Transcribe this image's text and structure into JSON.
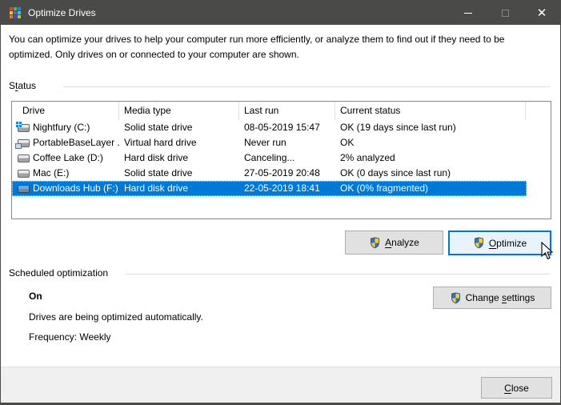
{
  "window": {
    "title": "Optimize Drives"
  },
  "intro_lines": [
    "You can optimize your drives to help your computer run more efficiently, or analyze them to find out if they need to be",
    "optimized. Only drives on or connected to your computer are shown."
  ],
  "sections": {
    "status": {
      "label_pre": "S",
      "label_key": "t",
      "label_post": "atus"
    },
    "scheduled": {
      "label": "Scheduled optimization",
      "state": "On",
      "description": "Drives are being optimized automatically.",
      "frequency": "Frequency: Weekly"
    }
  },
  "table": {
    "columns": [
      "Drive",
      "Media type",
      "Last run",
      "Current status"
    ],
    "rows": [
      {
        "icon": "drive-windows-icon",
        "drive": "Nightfury (C:)",
        "media_type": "Solid state drive",
        "last_run": "08-05-2019 15:47",
        "current_status": "OK (19 days since last run)",
        "selected": false
      },
      {
        "icon": "virtual-drive-icon",
        "drive": "PortableBaseLayer ...",
        "media_type": "Virtual hard drive",
        "last_run": "Never run",
        "current_status": "OK",
        "selected": false
      },
      {
        "icon": "drive-icon",
        "drive": "Coffee Lake (D:)",
        "media_type": "Hard disk drive",
        "last_run": "Canceling...",
        "current_status": "2% analyzed",
        "selected": false
      },
      {
        "icon": "drive-icon",
        "drive": "Mac (E:)",
        "media_type": "Solid state drive",
        "last_run": "27-05-2019 20:48",
        "current_status": "OK (0 days since last run)",
        "selected": false
      },
      {
        "icon": "drive-selected-icon",
        "drive": "Downloads Hub (F:)",
        "media_type": "Hard disk drive",
        "last_run": "22-05-2019 18:41",
        "current_status": "OK (0% fragmented)",
        "selected": true
      }
    ]
  },
  "buttons": {
    "analyze": {
      "pre": "",
      "key": "A",
      "post": "nalyze"
    },
    "optimize": {
      "pre": "",
      "key": "O",
      "post": "ptimize"
    },
    "change_settings": {
      "pre": "Change ",
      "key": "s",
      "post": "ettings"
    },
    "close": {
      "pre": "",
      "key": "C",
      "post": "lose"
    }
  },
  "colors": {
    "titlebar": "#4a4a48",
    "selection": "#0078d7",
    "footer": "#f0f0f0",
    "button_face": "#e1e1e1",
    "focused_button_face": "#e9f3fb",
    "focused_button_border": "#0078d7",
    "shield_blue": "#3b6fb6",
    "shield_yellow": "#f8d22a"
  }
}
